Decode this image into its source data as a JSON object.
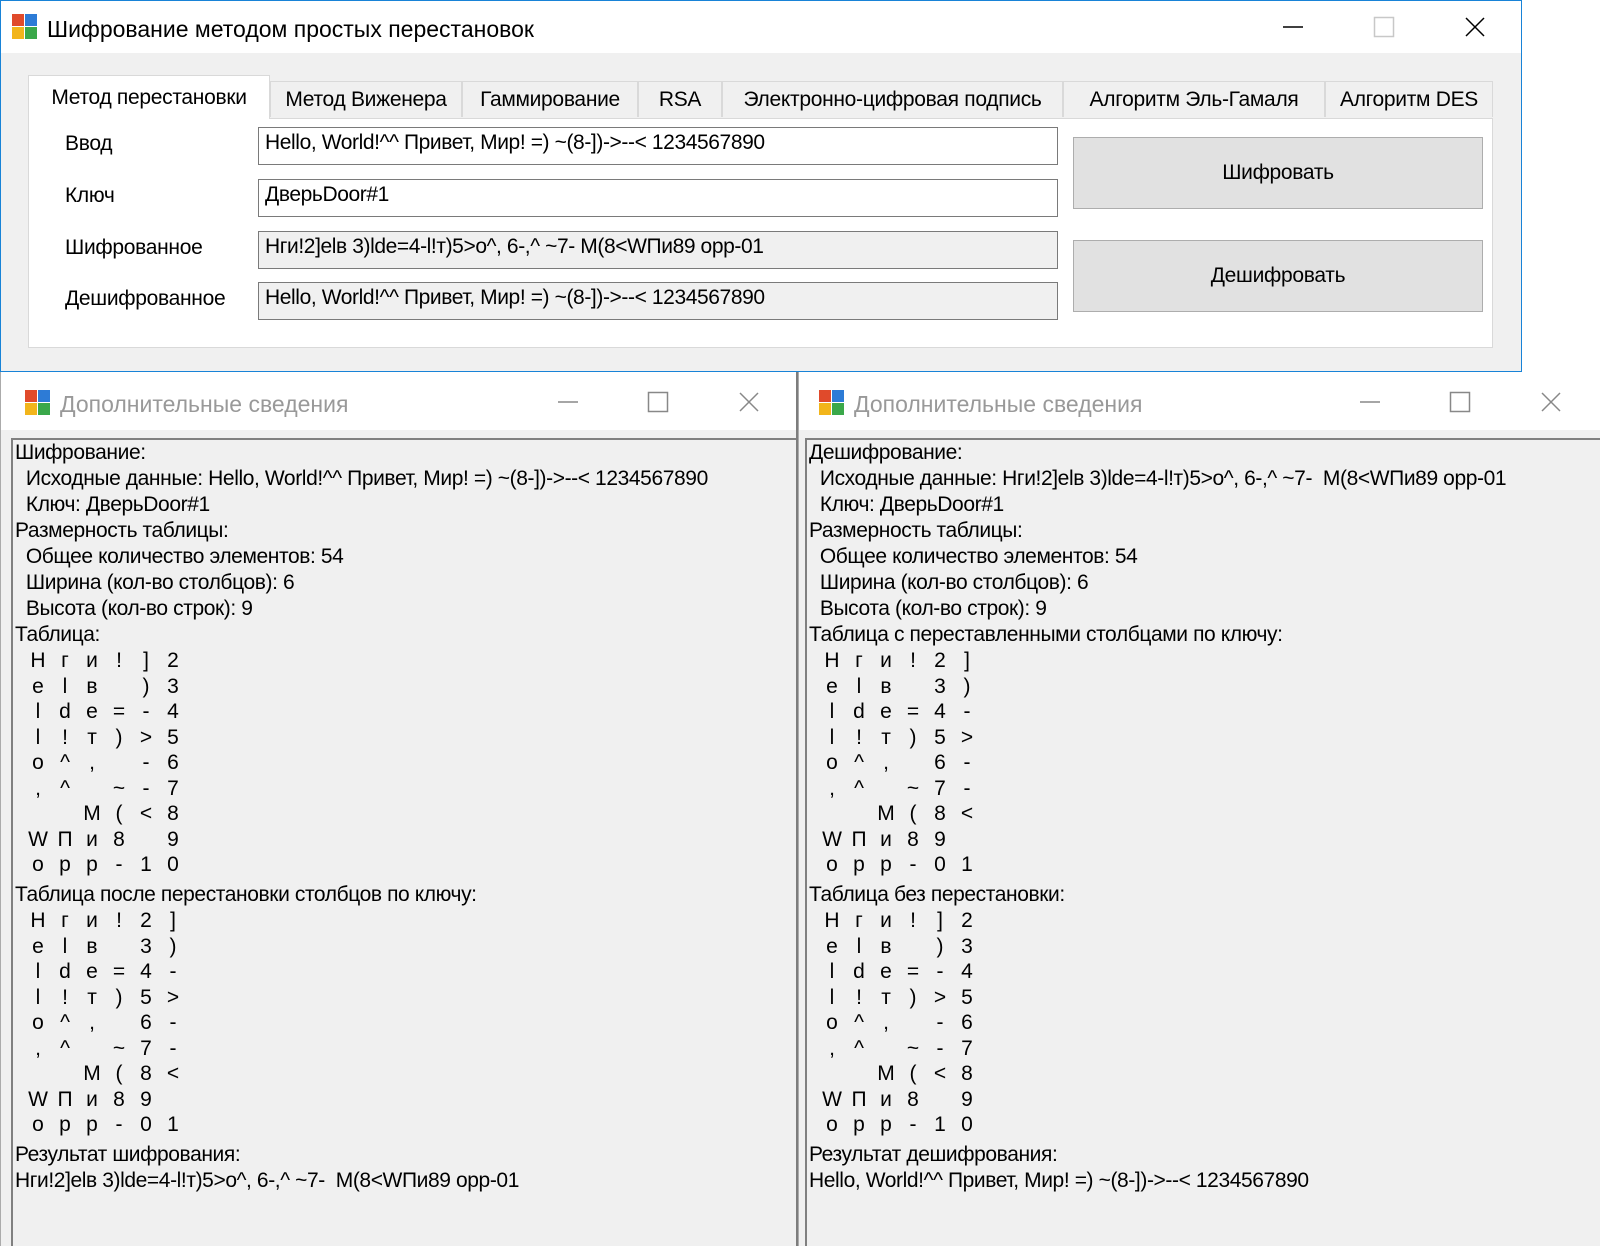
{
  "main_window": {
    "title": "Шифрование методом простых перестановок",
    "tabs": [
      "Метод перестановки",
      "Метод Виженера",
      "Гаммирование",
      "RSA",
      "Электронно-цифровая подпись",
      "Алгоритм Эль-Гамаля",
      "Алгоритм DES"
    ],
    "active_tab": "Метод перестановки",
    "fields": [
      {
        "label": "Ввод",
        "value": "Hello, World!^^ Привет, Мир! =) ~(8-])->--< 1234567890"
      },
      {
        "label": "Ключ",
        "value": "ДверьDoor#1"
      },
      {
        "label": "Шифрованное",
        "value": "Hги!2]elв 3)lde=4-l!т)5>o^, 6-,^ ~7-  M(8<WПи89 opp-01"
      },
      {
        "label": "Дешифрованное",
        "value": "Hello, World!^^ Привет, Мир! =) ~(8-])->--< 1234567890"
      }
    ],
    "buttons": {
      "encrypt": "Шифровать",
      "decrypt": "Дешифровать"
    }
  },
  "info_left": {
    "title": "Дополнительные сведения",
    "header": "Шифрование:",
    "source_line": "  Исходные данные: Hello, World!^^ Привет, Мир! =) ~(8-])->--< 1234567890",
    "key_line": "  Ключ: ДверьDoor#1",
    "dims_header": "Размерность таблицы:",
    "total_line": "  Общее количество элементов: 54",
    "width_line": "  Ширина (кол-во столбцов): 6",
    "height_line": "  Высота (кол-во строк): 9",
    "table1_header": "Таблица:",
    "table1": [
      [
        "H",
        "г",
        "и",
        "!",
        "]",
        "2"
      ],
      [
        "e",
        "l",
        "в",
        " ",
        ")",
        "3"
      ],
      [
        "l",
        "d",
        "e",
        "=",
        "-",
        "4"
      ],
      [
        "l",
        "!",
        "т",
        ")",
        ">",
        "5"
      ],
      [
        "o",
        "^",
        ",",
        " ",
        "-",
        "6"
      ],
      [
        ",",
        "^",
        " ",
        "~",
        "-",
        "7"
      ],
      [
        " ",
        " ",
        "M",
        "(",
        "<",
        "8"
      ],
      [
        "W",
        "П",
        "и",
        "8",
        " ",
        "9"
      ],
      [
        "o",
        "p",
        "p",
        "-",
        "1",
        "0"
      ]
    ],
    "table2_header": "Таблица после перестановки столбцов по ключу:",
    "table2": [
      [
        "H",
        "г",
        "и",
        "!",
        "2",
        "]"
      ],
      [
        "e",
        "l",
        "в",
        " ",
        "3",
        ")"
      ],
      [
        "l",
        "d",
        "e",
        "=",
        "4",
        "-"
      ],
      [
        "l",
        "!",
        "т",
        ")",
        "5",
        ">"
      ],
      [
        "o",
        "^",
        ",",
        " ",
        "6",
        "-"
      ],
      [
        ",",
        "^",
        " ",
        "~",
        "7",
        "-"
      ],
      [
        " ",
        " ",
        "M",
        "(",
        "8",
        "<"
      ],
      [
        "W",
        "П",
        "и",
        "8",
        "9",
        " "
      ],
      [
        "o",
        "p",
        "p",
        "-",
        "0",
        "1"
      ]
    ],
    "result_header": "Результат шифрования:",
    "result": "Hги!2]elв 3)lde=4-l!т)5>o^, 6-,^ ~7-  M(8<WПи89 opp-01"
  },
  "info_right": {
    "title": "Дополнительные сведения",
    "header": "Дешифрование:",
    "source_line": "  Исходные данные: Hги!2]elв 3)lde=4-l!т)5>o^, 6-,^ ~7-  M(8<WПи89 opp-01",
    "key_line": "  Ключ: ДверьDoor#1",
    "dims_header": "Размерность таблицы:",
    "total_line": "  Общее количество элементов: 54",
    "width_line": "  Ширина (кол-во столбцов): 6",
    "height_line": "  Высота (кол-во строк): 9",
    "table1_header": "Таблица с переставленными столбцами по ключу:",
    "table1": [
      [
        "H",
        "г",
        "и",
        "!",
        "2",
        "]"
      ],
      [
        "e",
        "l",
        "в",
        " ",
        "3",
        ")"
      ],
      [
        "l",
        "d",
        "e",
        "=",
        "4",
        "-"
      ],
      [
        "l",
        "!",
        "т",
        ")",
        "5",
        ">"
      ],
      [
        "o",
        "^",
        ",",
        " ",
        "6",
        "-"
      ],
      [
        ",",
        "^",
        " ",
        "~",
        "7",
        "-"
      ],
      [
        " ",
        " ",
        "M",
        "(",
        "8",
        "<"
      ],
      [
        "W",
        "П",
        "и",
        "8",
        "9",
        " "
      ],
      [
        "o",
        "p",
        "p",
        "-",
        "0",
        "1"
      ]
    ],
    "table2_header": "Таблица без перестановки:",
    "table2": [
      [
        "H",
        "г",
        "и",
        "!",
        "]",
        "2"
      ],
      [
        "e",
        "l",
        "в",
        " ",
        ")",
        "3"
      ],
      [
        "l",
        "d",
        "e",
        "=",
        "-",
        "4"
      ],
      [
        "l",
        "!",
        "т",
        ")",
        ">",
        "5"
      ],
      [
        "o",
        "^",
        ",",
        " ",
        "-",
        "6"
      ],
      [
        ",",
        "^",
        " ",
        "~",
        "-",
        "7"
      ],
      [
        " ",
        " ",
        "M",
        "(",
        "<",
        "8"
      ],
      [
        "W",
        "П",
        "и",
        "8",
        " ",
        "9"
      ],
      [
        "o",
        "p",
        "p",
        "-",
        "1",
        "0"
      ]
    ],
    "result_header": "Результат дешифрования:",
    "result": "Hello, World!^^ Привет, Мир! =) ~(8-])->--< 1234567890"
  },
  "colors": {
    "window_border": "#1883d7",
    "face": "#f0f0f0",
    "button": "#e1e1e1",
    "inactive_title": "#999999"
  }
}
